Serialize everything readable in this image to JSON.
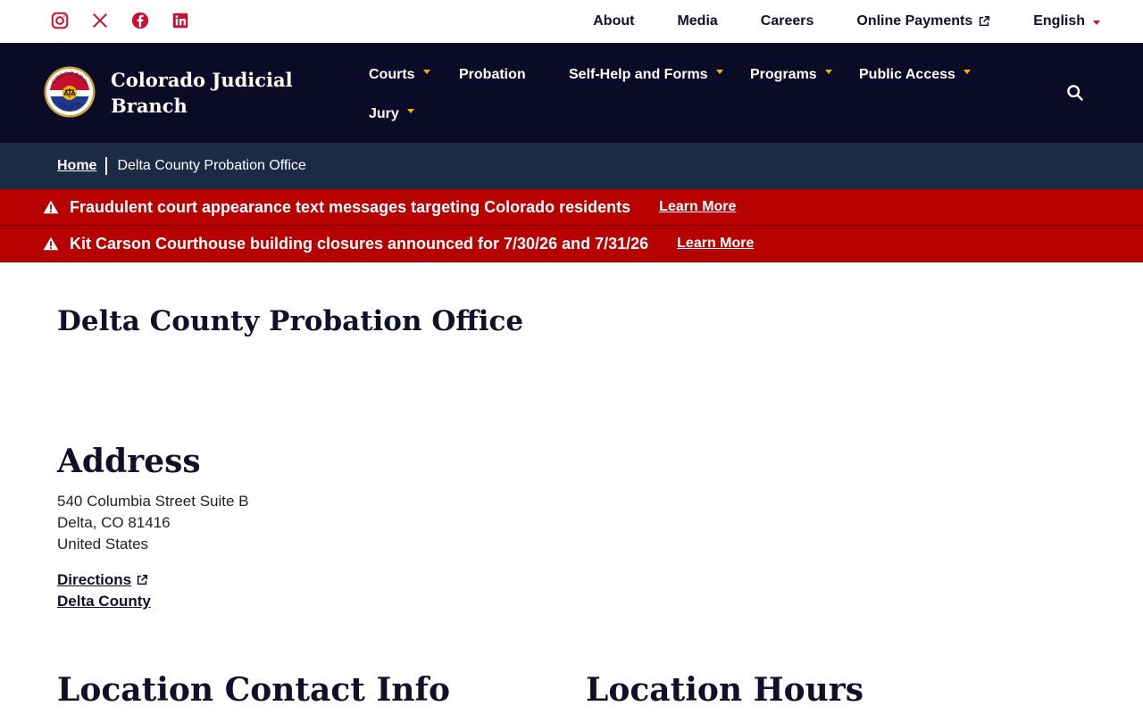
{
  "utility_nav": {
    "social_icons": [
      "instagram-icon",
      "x-icon",
      "facebook-icon",
      "linkedin-icon"
    ],
    "links": [
      {
        "label": "About"
      },
      {
        "label": "Media"
      },
      {
        "label": "Careers"
      },
      {
        "label": "Online Payments",
        "external": true
      }
    ],
    "language": "English"
  },
  "header": {
    "brand_name": "Colorado Judicial Branch",
    "seal_lines": {
      "top": "COLORADO",
      "bottom": "COURTS"
    },
    "nav": [
      {
        "label": "Courts",
        "dropdown": true
      },
      {
        "label": "Probation",
        "dropdown": false
      },
      {
        "label": "Self-Help and Forms",
        "dropdown": true
      },
      {
        "label": "Programs",
        "dropdown": true
      },
      {
        "label": "Public Access",
        "dropdown": true
      },
      {
        "label": "Jury",
        "dropdown": true
      }
    ]
  },
  "breadcrumb": {
    "home": "Home",
    "current": "Delta County Probation Office"
  },
  "alerts": [
    {
      "text": "Fraudulent court appearance text messages targeting Colorado residents",
      "link": "Learn More"
    },
    {
      "text": "Kit Carson Courthouse building closures announced for 7/30/26 and 7/31/26",
      "link": "Learn More"
    }
  ],
  "page": {
    "title": "Delta County Probation Office",
    "address_heading": "Address",
    "address_lines": [
      "540 Columbia Street Suite B",
      "Delta, CO 81416",
      "United States"
    ],
    "directions_link": "Directions",
    "county_link": "Delta County",
    "contact_heading": "Location Contact Info",
    "hours_heading": "Location Hours"
  },
  "colors": {
    "accent_red": "#c8102e",
    "header_navy": "#0b0b27",
    "breadcrumb_blue": "#1b2b45",
    "alert_red": "#b70000",
    "nav_caret_gold": "#f2b705"
  }
}
